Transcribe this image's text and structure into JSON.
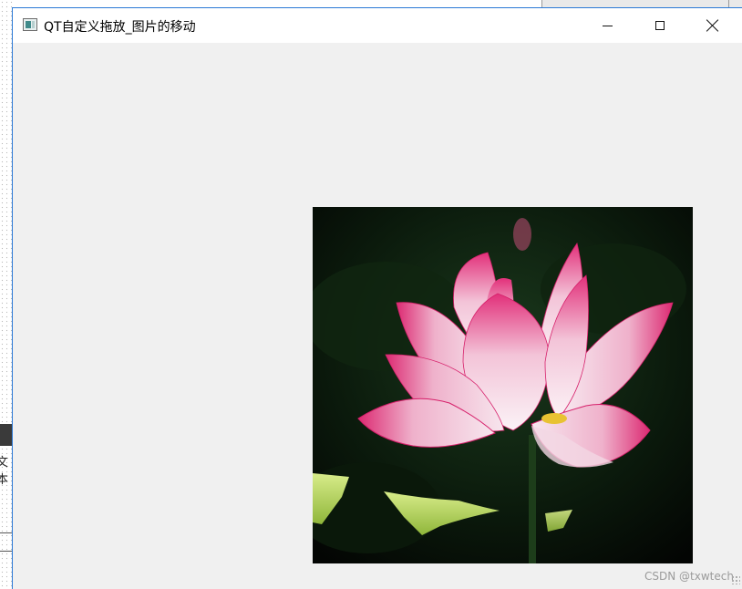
{
  "window": {
    "title": "QT自定义拖放_图片的移动",
    "icon": "qt-app-icon",
    "controls": {
      "minimize": "minimize-icon",
      "maximize": "maximize-icon",
      "close": "close-icon"
    }
  },
  "picture": {
    "subject": "lotus-flower-image"
  },
  "background": {
    "left_text": "文本"
  },
  "watermark": "CSDN @txwtech",
  "colors": {
    "accent_border": "#2b79d6",
    "client_bg": "#f0f0f0",
    "titlebar_bg": "#ffffff"
  }
}
